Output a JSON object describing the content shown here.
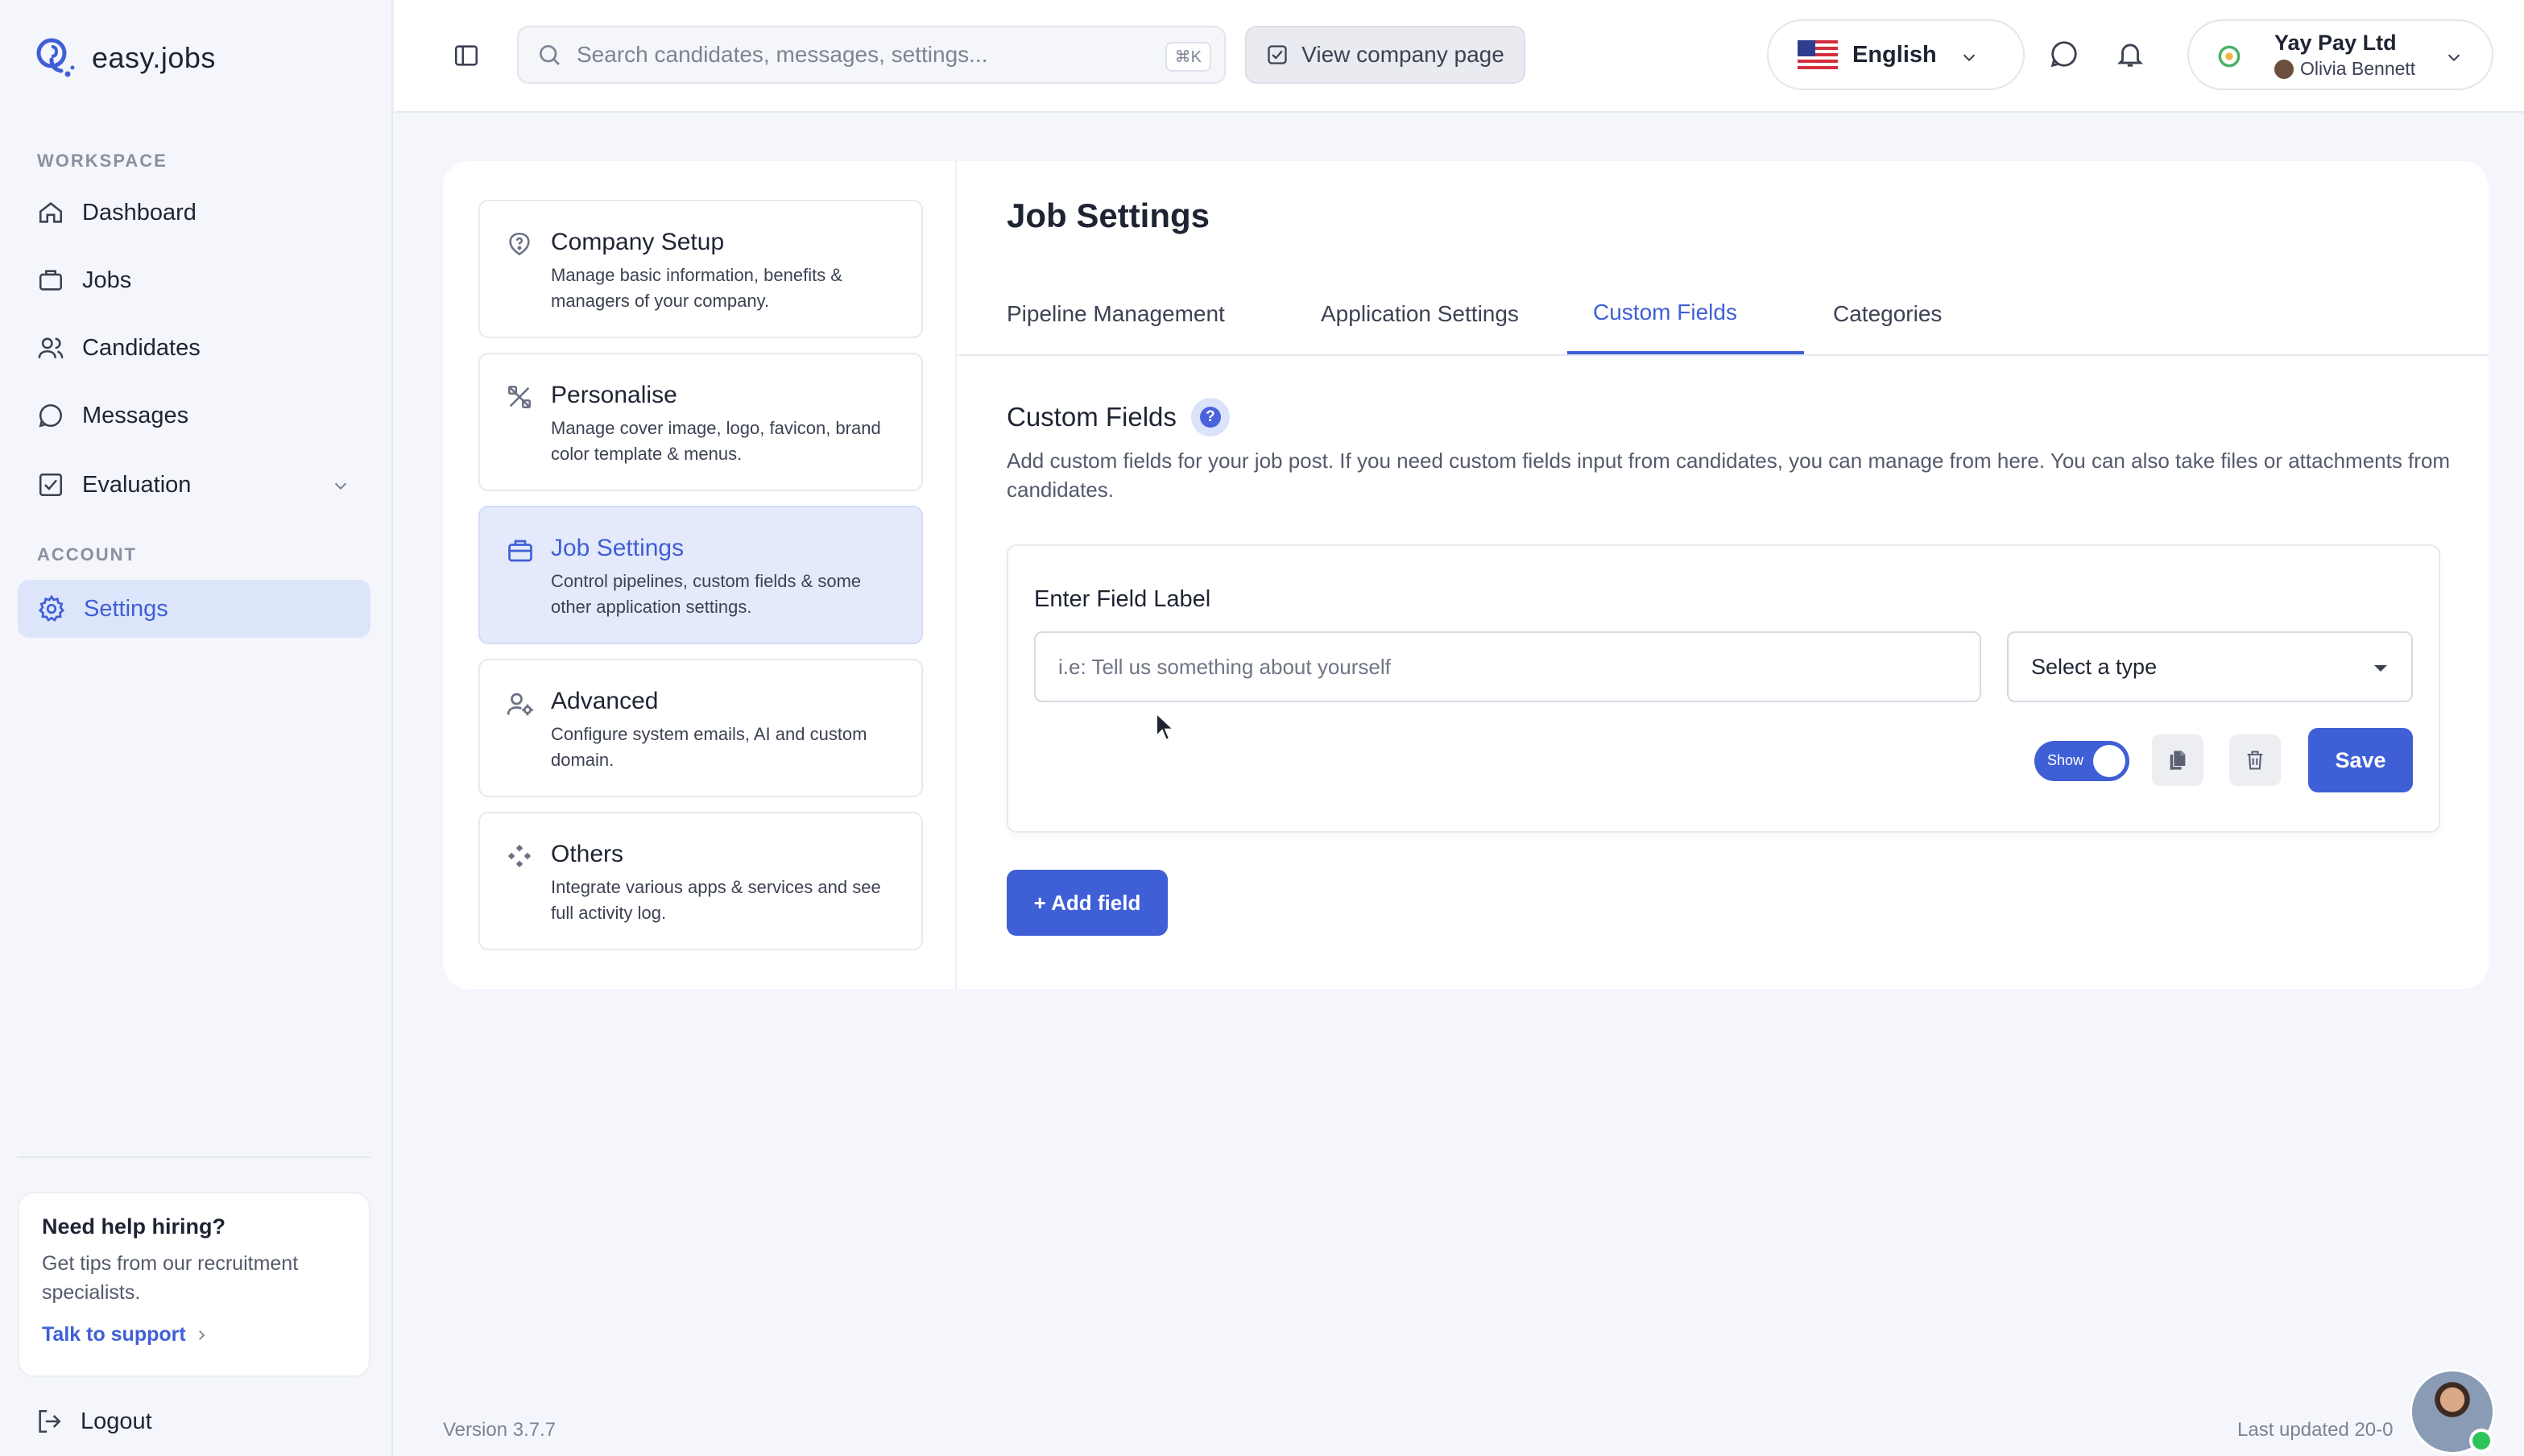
{
  "brand": {
    "name": "easy.jobs"
  },
  "sidebar": {
    "workspace_label": "WORKSPACE",
    "account_label": "ACCOUNT",
    "items": [
      {
        "label": "Dashboard",
        "icon": "home-icon"
      },
      {
        "label": "Jobs",
        "icon": "briefcase-icon"
      },
      {
        "label": "Candidates",
        "icon": "users-icon"
      },
      {
        "label": "Messages",
        "icon": "message-icon"
      },
      {
        "label": "Evaluation",
        "icon": "checklist-icon"
      }
    ],
    "settings": {
      "label": "Settings",
      "icon": "gear-icon"
    },
    "help": {
      "title": "Need help hiring?",
      "text": "Get tips from our recruitment specialists.",
      "link": "Talk to support"
    },
    "logout": "Logout"
  },
  "header": {
    "search_placeholder": "Search candidates, messages, settings...",
    "shortcut": "⌘K",
    "view_company": "View company page",
    "language": "English",
    "company": "Yay Pay Ltd",
    "user": "Olivia Bennett"
  },
  "settings_nav": [
    {
      "title": "Company Setup",
      "desc": "Manage basic information, benefits & managers of your company.",
      "icon": "question-shield-icon"
    },
    {
      "title": "Personalise",
      "desc": "Manage cover image, logo, favicon, brand color template & menus.",
      "icon": "design-tools-icon"
    },
    {
      "title": "Job Settings",
      "desc": "Control pipelines, custom fields & some other application settings.",
      "icon": "briefcase-icon"
    },
    {
      "title": "Advanced",
      "desc": "Configure system emails, AI and custom domain.",
      "icon": "user-gear-icon"
    },
    {
      "title": "Others",
      "desc": "Integrate various apps & services and see full activity log.",
      "icon": "apps-icon"
    }
  ],
  "page": {
    "title": "Job Settings",
    "tabs": [
      "Pipeline Management",
      "Application Settings",
      "Custom Fields",
      "Categories"
    ],
    "active_tab": "Custom Fields",
    "section_title": "Custom Fields",
    "section_desc": "Add custom fields for your job post. If you need custom fields input from candidates, you can manage from here. You can also take files or attachments from candidates.",
    "field": {
      "label": "Enter Field Label",
      "placeholder": "i.e: Tell us something about yourself",
      "value": "",
      "type_placeholder": "Select a type",
      "toggle_label": "Show",
      "toggle_on": true,
      "save": "Save"
    },
    "add_field": "+ Add field"
  },
  "footer": {
    "version": "Version 3.7.7",
    "last_updated": "Last updated 20-0"
  },
  "colors": {
    "accent": "#3f5fd6",
    "active_bg": "#dde5fb",
    "background": "#f4f6fb",
    "online": "#2fc45b"
  }
}
